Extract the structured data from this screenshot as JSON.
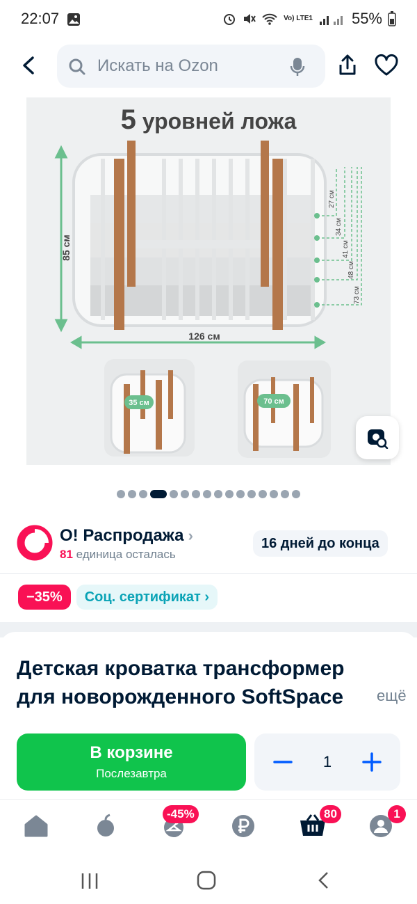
{
  "status_bar": {
    "time": "22:07",
    "battery": "55%",
    "network": "Vo) LTE1"
  },
  "header": {
    "search_placeholder": "Искать на Ozon"
  },
  "gallery": {
    "title_number": "5",
    "title_text": "уровней ложа",
    "height_label": "85 см",
    "width_label": "126 см",
    "level_labels": [
      "27 см",
      "34 см",
      "41 см",
      "48 см",
      "73 см"
    ],
    "thumb1_label": "35 см",
    "thumb2_label": "70 см",
    "dots_total": 16,
    "dots_active_index": 3
  },
  "sale": {
    "title": "О! Распродажа",
    "units_left_number": "81",
    "units_left_text": "единица осталась",
    "days_left": "16 дней до конца"
  },
  "badges": {
    "discount": "−35%",
    "certificate": "Соц. сертификат"
  },
  "product": {
    "title": "Детская кроватка трансформер для новорожденного SoftSpace",
    "more": "ещё"
  },
  "cart": {
    "label": "В корзине",
    "delivery": "Послезавтра",
    "quantity": "1"
  },
  "bottom_nav": {
    "fresh_badge": "-45%",
    "cart_badge": "80",
    "profile_badge": "1"
  },
  "colors": {
    "accent_pink": "#f91155",
    "green": "#10c44c",
    "ozon_blue": "#005bff",
    "text_dark": "#001a34"
  }
}
